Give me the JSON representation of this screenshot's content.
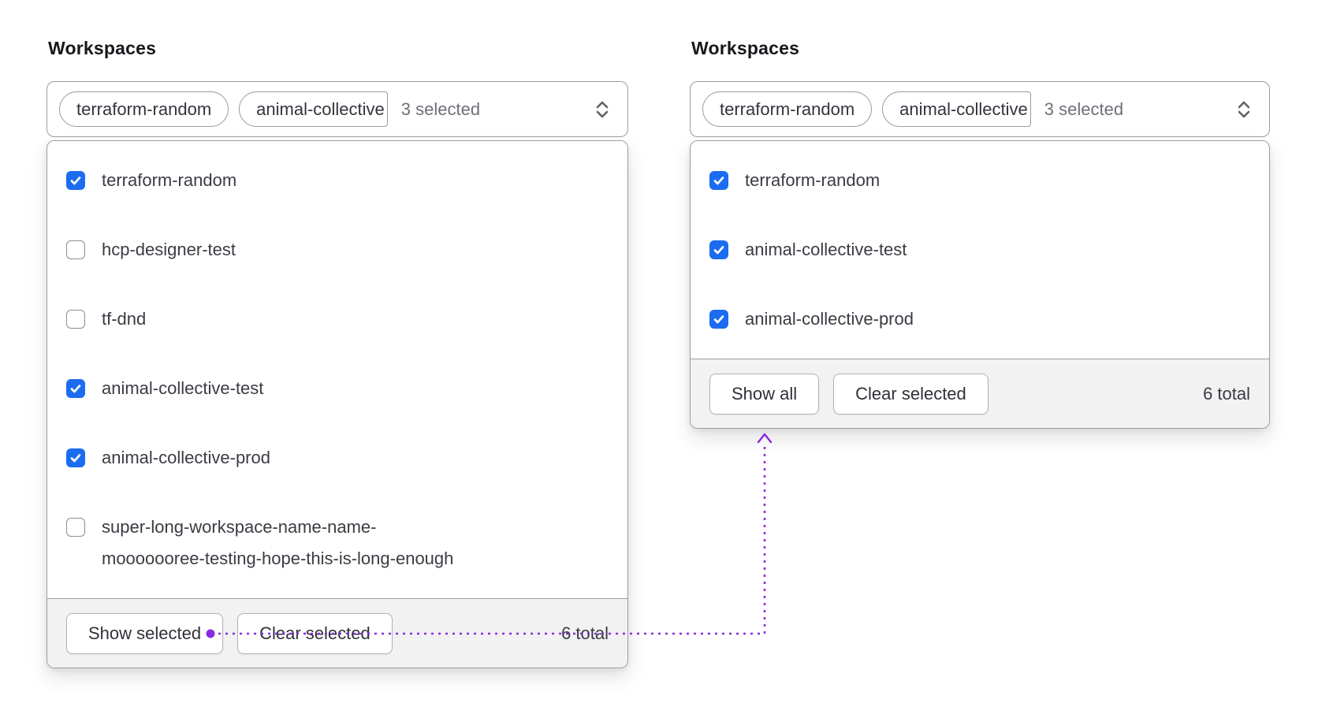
{
  "colors": {
    "accent_purple": "#8a2be2",
    "checkbox_blue": "#1b6cf0"
  },
  "left": {
    "label": "Workspaces",
    "trigger": {
      "tags": [
        "terraform-random",
        "animal-collective"
      ],
      "summary": "3 selected"
    },
    "options": [
      {
        "label": "terraform-random",
        "checked": true
      },
      {
        "label": "hcp-designer-test",
        "checked": false
      },
      {
        "label": "tf-dnd",
        "checked": false
      },
      {
        "label": "animal-collective-test",
        "checked": true
      },
      {
        "label": "animal-collective-prod",
        "checked": true
      },
      {
        "label_lines": [
          "super-long-workspace-name-name-",
          "mooooooree-testing-hope-this-is-long-enough"
        ],
        "checked": false
      }
    ],
    "footer": {
      "show_button": "Show selected",
      "clear_button": "Clear selected",
      "total": "6 total"
    }
  },
  "right": {
    "label": "Workspaces",
    "trigger": {
      "tags": [
        "terraform-random",
        "animal-collective"
      ],
      "summary": "3 selected"
    },
    "options": [
      {
        "label": "terraform-random",
        "checked": true
      },
      {
        "label": "animal-collective-test",
        "checked": true
      },
      {
        "label": "animal-collective-prod",
        "checked": true
      }
    ],
    "footer": {
      "show_button": "Show all",
      "clear_button": "Clear selected",
      "total": "6 total"
    }
  }
}
